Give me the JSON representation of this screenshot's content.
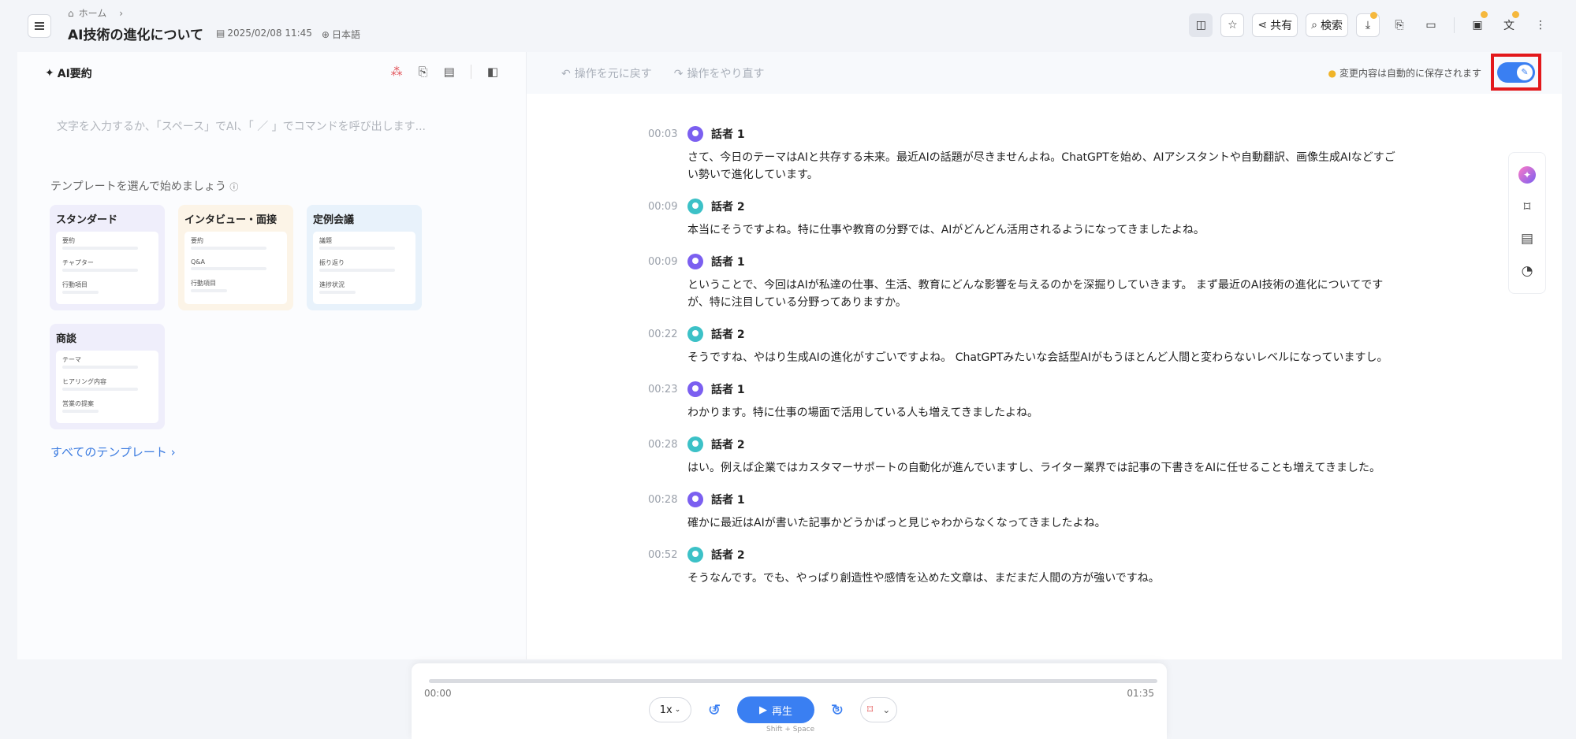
{
  "header": {
    "breadcrumb_home": "ホーム",
    "title": "AI技術の進化について",
    "date": "2025/02/08 11:45",
    "language": "日本語",
    "share_label": "共有",
    "search_label": "検索"
  },
  "left": {
    "title": "AI要約",
    "placeholder": "文字を入力するか、「スペース」でAI、「 ／ 」でコマンドを呼び出します...",
    "template_prompt": "テンプレートを選んで始めましょう",
    "templates": [
      {
        "name": "スタンダード",
        "rows": [
          "要約",
          "チャプター",
          "行動項目"
        ]
      },
      {
        "name": "インタビュー・面接",
        "rows": [
          "要約",
          "Q&A",
          "行動項目"
        ]
      },
      {
        "name": "定例会議",
        "rows": [
          "議題",
          "振り返り",
          "進捗状況"
        ]
      },
      {
        "name": "商談",
        "rows": [
          "テーマ",
          "ヒアリング内容",
          "営業の提案"
        ]
      }
    ],
    "all_templates": "すべてのテンプレート ›"
  },
  "right": {
    "undo": "操作を元に戻す",
    "redo": "操作をやり直す",
    "autosave": "変更内容は自動的に保存されます",
    "edit_toggle_on": true,
    "segments": [
      {
        "time": "00:03",
        "speaker": "話者 1",
        "text": "さて、今日のテーマはAIと共存する未来。最近AIの話題が尽きませんよね。ChatGPTを始め、AIアシスタントや自動翻訳、画像生成AIなどすごい勢いで進化しています。"
      },
      {
        "time": "00:09",
        "speaker": "話者 2",
        "text": "本当にそうですよね。特に仕事や教育の分野では、AIがどんどん活用されるようになってきましたよね。"
      },
      {
        "time": "00:09",
        "speaker": "話者 1",
        "text": "ということで、今回はAIが私達の仕事、生活、教育にどんな影響を与えるのかを深掘りしていきます。 まず最近のAI技術の進化についてですが、特に注目している分野ってありますか。"
      },
      {
        "time": "00:22",
        "speaker": "話者 2",
        "text": "そうですね、やはり生成AIの進化がすごいですよね。 ChatGPTみたいな会話型AIがもうほとんど人間と変わらないレベルになっていますし。"
      },
      {
        "time": "00:23",
        "speaker": "話者 1",
        "text": "わかります。特に仕事の場面で活用している人も増えてきましたよね。"
      },
      {
        "time": "00:28",
        "speaker": "話者 2",
        "text": "はい。例えば企業ではカスタマーサポートの自動化が進んでいますし、ライター業界では記事の下書きをAIに任せることも増えてきました。"
      },
      {
        "time": "00:28",
        "speaker": "話者 1",
        "text": "確かに最近はAIが書いた記事かどうかぱっと見じゃわからなくなってきましたよね。"
      },
      {
        "time": "00:52",
        "speaker": "話者 2",
        "text": "そうなんです。でも、やっぱり創造性や感情を込めた文章は、まだまだ人間の方が強いですね。"
      }
    ]
  },
  "player": {
    "current": "00:00",
    "duration": "01:35",
    "progress": 0,
    "speed": "1x",
    "skip_back": "3",
    "skip_fwd": "3",
    "play_label": "再生",
    "shortcut": "Shift + Space"
  },
  "colors": {
    "accent": "#3a7ff2",
    "highlight_frame": "#e3191c",
    "speaker1": "#7b5ff0",
    "speaker2": "#3cc1c7"
  }
}
